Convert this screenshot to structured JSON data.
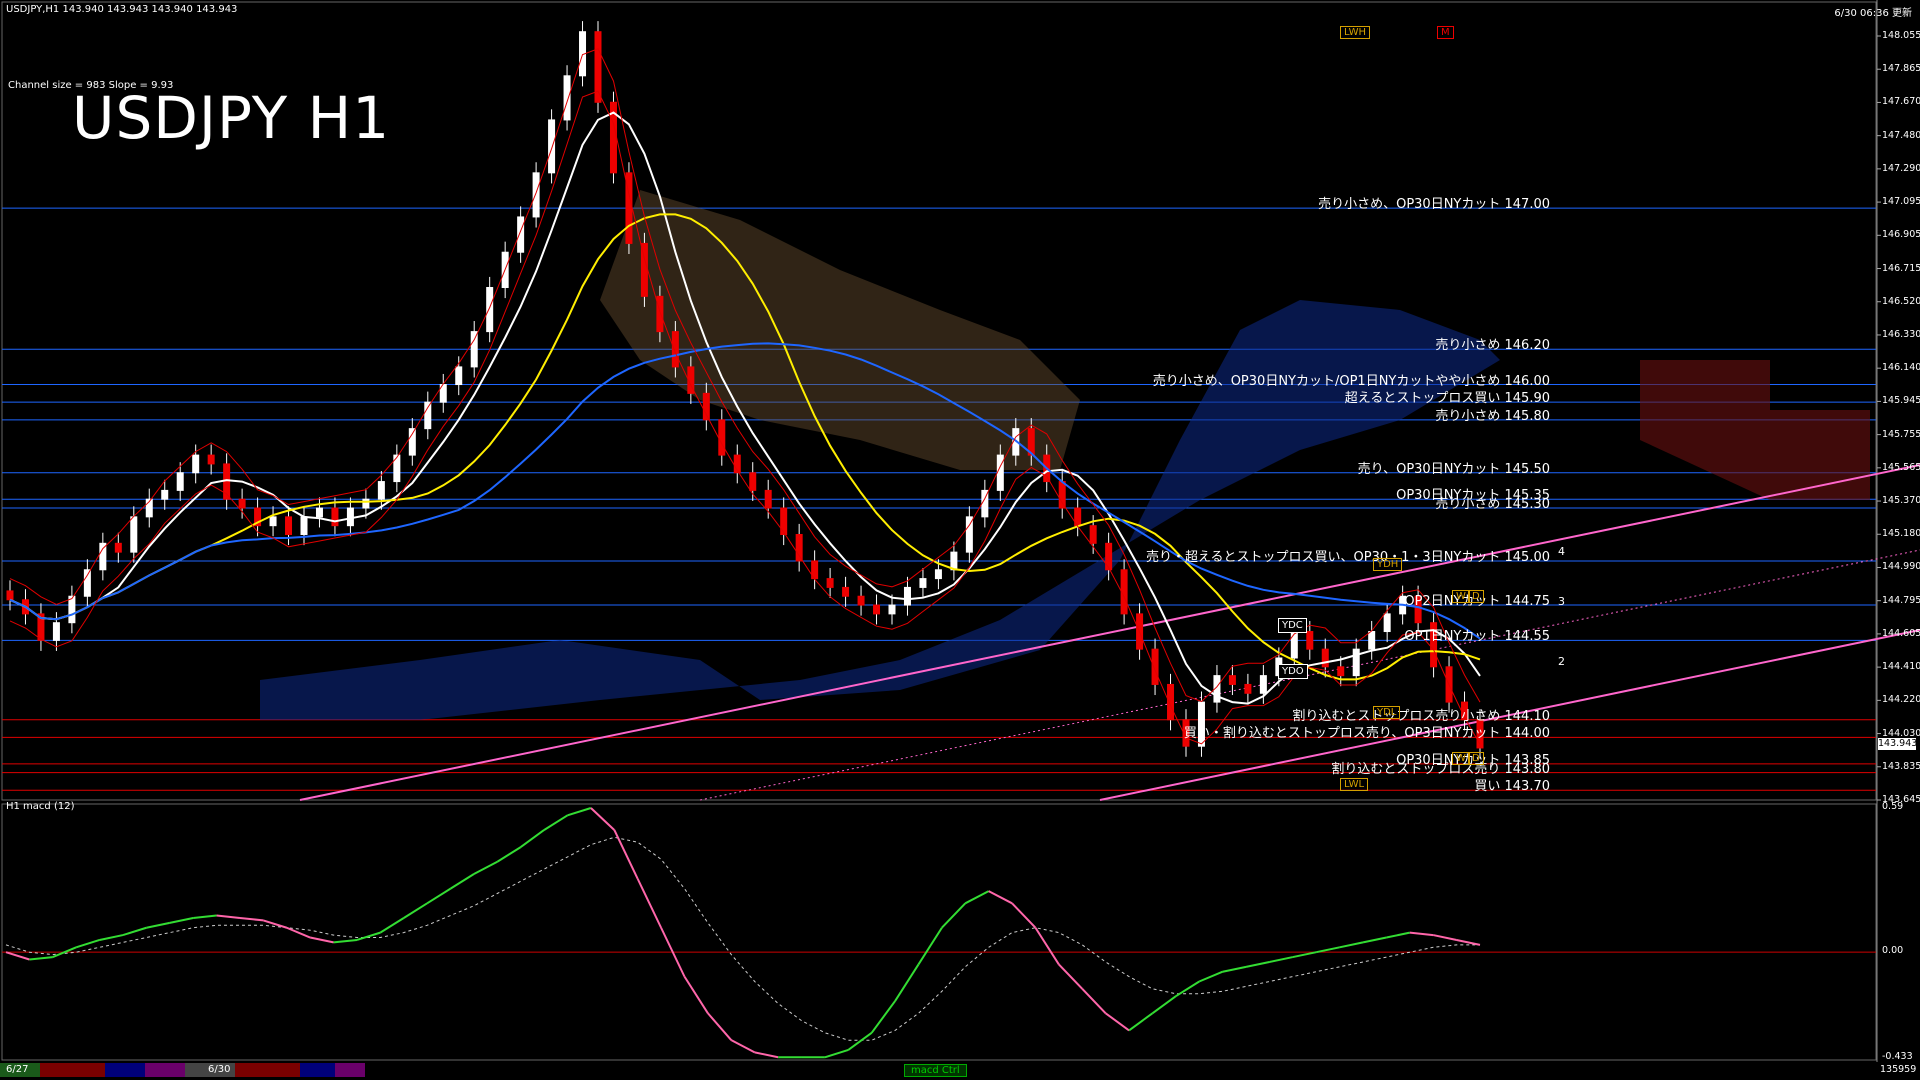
{
  "header": {
    "symbol_line": "USDJPY,H1  143.940 143.943 143.940 143.943",
    "clock": "6/30 06:36 更新",
    "channel_info": "Channel size = 983 Slope = 9.93",
    "big_title": "USDJPY H1",
    "macd_title": "H1  macd (12)"
  },
  "colors": {
    "background": "#000000",
    "blue_line": "#1e66ff",
    "red_line": "#e00000",
    "magenta_channel": "#ff66cc",
    "white_ma": "#ffffff",
    "yellow_ma": "#ffee00",
    "green_line": "#00c000",
    "macd_pos": "#33dd33",
    "macd_neg": "#ff66aa"
  },
  "price_axis": {
    "labels": [
      "148.055",
      "147.865",
      "147.670",
      "147.480",
      "147.290",
      "147.095",
      "146.905",
      "146.715",
      "146.520",
      "146.330",
      "146.140",
      "145.945",
      "145.755",
      "145.565",
      "145.370",
      "145.180",
      "144.990",
      "144.795",
      "144.605",
      "144.410",
      "144.220",
      "144.030",
      "143.835",
      "143.645"
    ],
    "current_price": "143.943"
  },
  "macd_axis": {
    "labels": [
      "0.59",
      "0.00",
      "-0.433"
    ]
  },
  "badges": {
    "lwh": "LWH",
    "m": "M",
    "ydh": "YDH",
    "ydc": "YDC",
    "ydo": "YDO",
    "ydl": "YDL",
    "lwl": "LWL",
    "w1": "W",
    "d1": "D",
    "w2": "W",
    "d2": "D"
  },
  "levels": [
    {
      "text": "売り小さめ、OP30日NYカット 147.00",
      "price": 147.0,
      "color": "#1e66ff"
    },
    {
      "text": "売り小さめ 146.20",
      "price": 146.2,
      "color": "#1e66ff"
    },
    {
      "text": "売り小さめ、OP30日NYカット/OP1日NYカットやや小さめ 146.00",
      "price": 146.0,
      "color": "#1e66ff"
    },
    {
      "text": "超えるとストップロス買い 145.90",
      "price": 145.9,
      "color": "#1e66ff"
    },
    {
      "text": "売り小さめ 145.80",
      "price": 145.8,
      "color": "#1e66ff"
    },
    {
      "text": "売り、OP30日NYカット 145.50",
      "price": 145.5,
      "color": "#1e66ff"
    },
    {
      "text": "OP30日NYカット 145.35",
      "price": 145.35,
      "color": "#1e66ff"
    },
    {
      "text": "売り小さめ 145.30",
      "price": 145.3,
      "color": "#1e66ff"
    },
    {
      "text": "売り・超えるとストップロス買い、OP30・1・3日NYカット 145.00",
      "price": 145.0,
      "color": "#1e66ff"
    },
    {
      "text": "OP2日NYカット 144.75",
      "price": 144.75,
      "color": "#1e66ff"
    },
    {
      "text": "OP1日NYカット 144.55",
      "price": 144.55,
      "color": "#1e66ff"
    },
    {
      "text": "割り込むとストップロス売り小さめ 144.10",
      "price": 144.1,
      "color": "#e00000"
    },
    {
      "text": "買い・割り込むとストップロス売り、OP3日NYカット 144.00",
      "price": 144.0,
      "color": "#e00000"
    },
    {
      "text": "OP30日NYカット 143.85",
      "price": 143.85,
      "color": "#e00000"
    },
    {
      "text": "割り込むとストップロス売り 143.80",
      "price": 143.8,
      "color": "#e00000"
    },
    {
      "text": "買い 143.70",
      "price": 143.7,
      "color": "#e00000"
    }
  ],
  "channel_labels": [
    "4",
    "3",
    "2"
  ],
  "bottom_bar": {
    "dates": [
      "6/27",
      "6/30"
    ],
    "macd_label": "macd Ctrl",
    "count": "135959"
  },
  "chart_data": {
    "type": "candlestick",
    "ylim": [
      143.645,
      148.055
    ],
    "macd_ylim": [
      -0.433,
      0.59
    ],
    "close": [
      144.78,
      144.7,
      144.55,
      144.65,
      144.8,
      144.95,
      145.1,
      145.05,
      145.25,
      145.35,
      145.4,
      145.5,
      145.6,
      145.55,
      145.35,
      145.3,
      145.2,
      145.25,
      145.15,
      145.25,
      145.3,
      145.2,
      145.3,
      145.35,
      145.45,
      145.6,
      145.75,
      145.9,
      146.0,
      146.1,
      146.3,
      146.55,
      146.75,
      146.95,
      147.2,
      147.5,
      147.75,
      148.0,
      147.6,
      147.2,
      146.8,
      146.5,
      146.3,
      146.1,
      145.95,
      145.8,
      145.6,
      145.5,
      145.4,
      145.3,
      145.15,
      145.0,
      144.9,
      144.85,
      144.8,
      144.75,
      144.7,
      144.75,
      144.85,
      144.9,
      144.95,
      145.05,
      145.25,
      145.4,
      145.6,
      145.75,
      145.6,
      145.45,
      145.3,
      145.2,
      145.1,
      144.95,
      144.7,
      144.5,
      144.3,
      144.1,
      143.95,
      144.2,
      144.35,
      144.3,
      144.25,
      144.35,
      144.45,
      144.6,
      144.5,
      144.4,
      144.35,
      144.5,
      144.6,
      144.7,
      144.8,
      144.65,
      144.4,
      144.2,
      144.1,
      143.94
    ],
    "macd": [
      0.0,
      -0.03,
      -0.02,
      0.02,
      0.05,
      0.07,
      0.1,
      0.12,
      0.14,
      0.15,
      0.14,
      0.13,
      0.1,
      0.06,
      0.04,
      0.05,
      0.08,
      0.14,
      0.2,
      0.26,
      0.32,
      0.37,
      0.43,
      0.5,
      0.56,
      0.59,
      0.5,
      0.3,
      0.1,
      -0.1,
      -0.25,
      -0.36,
      -0.41,
      -0.43,
      -0.43,
      -0.43,
      -0.4,
      -0.33,
      -0.2,
      -0.05,
      0.1,
      0.2,
      0.25,
      0.2,
      0.1,
      -0.05,
      -0.15,
      -0.25,
      -0.32,
      -0.25,
      -0.18,
      -0.12,
      -0.08,
      -0.06,
      -0.04,
      -0.02,
      0.0,
      0.02,
      0.04,
      0.06,
      0.08,
      0.07,
      0.05,
      0.03
    ],
    "signal": [
      0.03,
      0.0,
      -0.01,
      0.0,
      0.02,
      0.04,
      0.06,
      0.08,
      0.1,
      0.11,
      0.11,
      0.11,
      0.1,
      0.09,
      0.07,
      0.06,
      0.06,
      0.08,
      0.11,
      0.15,
      0.19,
      0.24,
      0.29,
      0.34,
      0.39,
      0.44,
      0.47,
      0.45,
      0.38,
      0.26,
      0.12,
      -0.01,
      -0.12,
      -0.21,
      -0.28,
      -0.33,
      -0.36,
      -0.36,
      -0.32,
      -0.25,
      -0.16,
      -0.06,
      0.02,
      0.08,
      0.1,
      0.08,
      0.03,
      -0.04,
      -0.1,
      -0.15,
      -0.17,
      -0.17,
      -0.16,
      -0.14,
      -0.12,
      -0.1,
      -0.08,
      -0.06,
      -0.04,
      -0.02,
      0.0,
      0.02,
      0.03,
      0.03
    ]
  }
}
